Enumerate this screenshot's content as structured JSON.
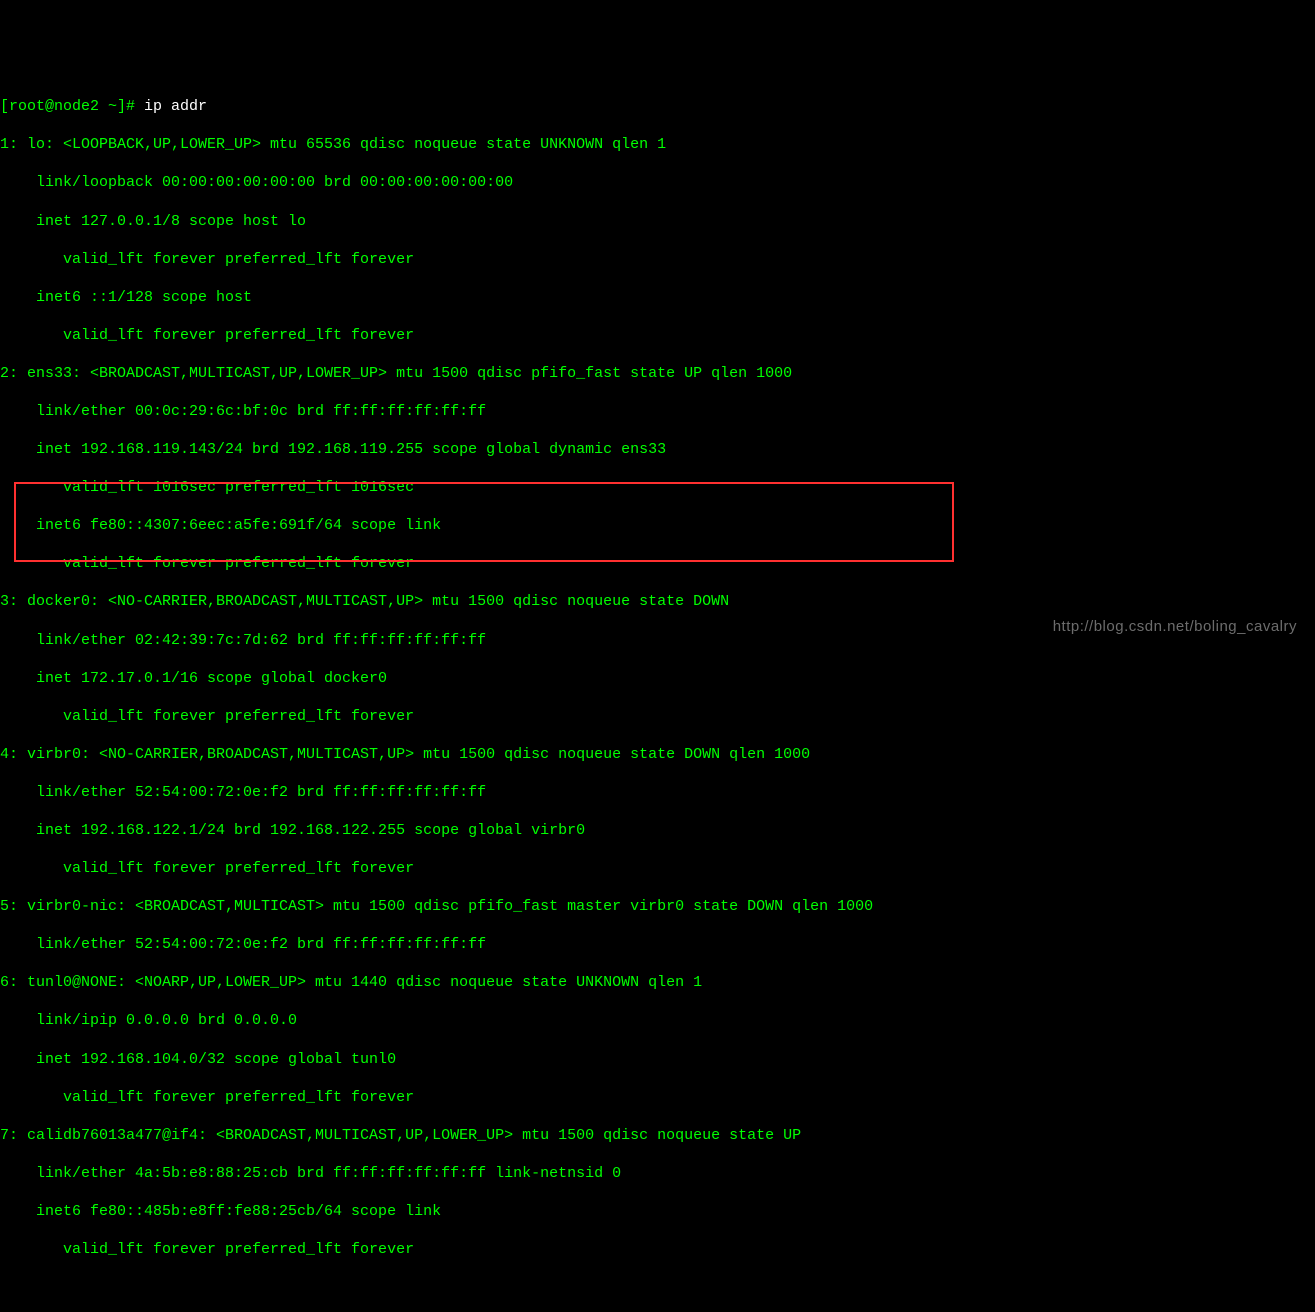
{
  "prompt": {
    "user_host": "[root@node2 ~]# ",
    "command": "ip addr"
  },
  "lines": {
    "l1": "1: lo: <LOOPBACK,UP,LOWER_UP> mtu 65536 qdisc noqueue state UNKNOWN qlen 1",
    "l2": "    link/loopback 00:00:00:00:00:00 brd 00:00:00:00:00:00",
    "l3": "    inet 127.0.0.1/8 scope host lo",
    "l4": "       valid_lft forever preferred_lft forever",
    "l5": "    inet6 ::1/128 scope host ",
    "l6": "       valid_lft forever preferred_lft forever",
    "l7": "2: ens33: <BROADCAST,MULTICAST,UP,LOWER_UP> mtu 1500 qdisc pfifo_fast state UP qlen 1000",
    "l8": "    link/ether 00:0c:29:6c:bf:0c brd ff:ff:ff:ff:ff:ff",
    "l9": "    inet 192.168.119.143/24 brd 192.168.119.255 scope global dynamic ens33",
    "l10": "       valid_lft 1016sec preferred_lft 1016sec",
    "l11": "    inet6 fe80::4307:6eec:a5fe:691f/64 scope link ",
    "l12": "       valid_lft forever preferred_lft forever",
    "l13": "3: docker0: <NO-CARRIER,BROADCAST,MULTICAST,UP> mtu 1500 qdisc noqueue state DOWN ",
    "l14": "    link/ether 02:42:39:7c:7d:62 brd ff:ff:ff:ff:ff:ff",
    "l15": "    inet 172.17.0.1/16 scope global docker0",
    "l16": "       valid_lft forever preferred_lft forever",
    "l17": "4: virbr0: <NO-CARRIER,BROADCAST,MULTICAST,UP> mtu 1500 qdisc noqueue state DOWN qlen 1000",
    "l18": "    link/ether 52:54:00:72:0e:f2 brd ff:ff:ff:ff:ff:ff",
    "l19": "    inet 192.168.122.1/24 brd 192.168.122.255 scope global virbr0",
    "l20": "       valid_lft forever preferred_lft forever",
    "l21": "5: virbr0-nic: <BROADCAST,MULTICAST> mtu 1500 qdisc pfifo_fast master virbr0 state DOWN qlen 1000",
    "l22": "    link/ether 52:54:00:72:0e:f2 brd ff:ff:ff:ff:ff:ff",
    "l23": "6: tunl0@NONE: <NOARP,UP,LOWER_UP> mtu 1440 qdisc noqueue state UNKNOWN qlen 1",
    "l24": "    link/ipip 0.0.0.0 brd 0.0.0.0",
    "l25": "    inet 192.168.104.0/32 scope global tunl0",
    "l26": "       valid_lft forever preferred_lft forever",
    "l27": "7: calidb76013a477@if4: <BROADCAST,MULTICAST,UP,LOWER_UP> mtu 1500 qdisc noqueue state UP ",
    "l28": "    link/ether 4a:5b:e8:88:25:cb brd ff:ff:ff:ff:ff:ff link-netnsid 0",
    "l29": "    inet6 fe80::485b:e8ff:fe88:25cb/64 scope link ",
    "l30": "       valid_lft forever preferred_lft forever"
  },
  "watermark": "http://blog.csdn.net/boling_cavalry"
}
